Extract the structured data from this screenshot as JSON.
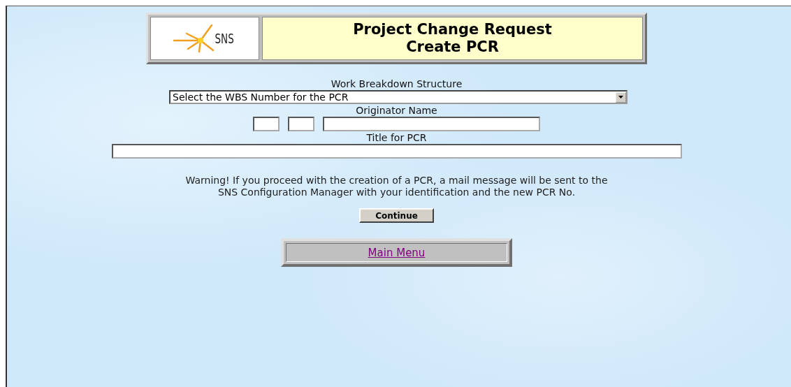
{
  "header": {
    "logo_text": "SNS",
    "title_lines": [
      "Project Change Request",
      "Create PCR"
    ]
  },
  "form": {
    "wbs_label": "Work Breakdown Structure",
    "wbs_select": "Select the WBS Number for the PCR",
    "originator_label": "Originator Name",
    "title_label": "Title for PCR"
  },
  "warning": "Warning! If you proceed with the creation of a PCR, a mail message will be sent to the SNS Configuration Manager with your identification and the new PCR No.",
  "continue_button": "Continue",
  "main_menu_link": "Main Menu"
}
